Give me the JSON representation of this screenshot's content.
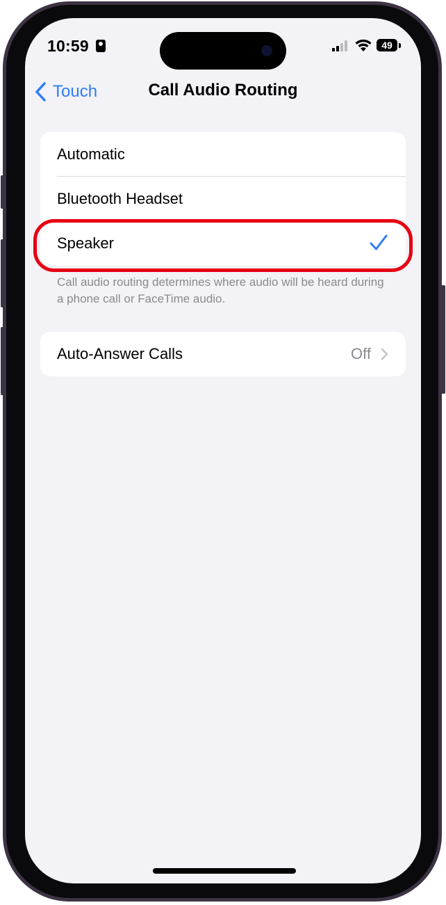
{
  "status_bar": {
    "time": "10:59",
    "battery": "49"
  },
  "nav": {
    "back_label": "Touch",
    "title": "Call Audio Routing"
  },
  "routing_options": [
    {
      "label": "Automatic",
      "selected": false
    },
    {
      "label": "Bluetooth Headset",
      "selected": false
    },
    {
      "label": "Speaker",
      "selected": true
    }
  ],
  "footnote": "Call audio routing determines where audio will be heard during a phone call or FaceTime audio.",
  "auto_answer": {
    "label": "Auto-Answer Calls",
    "value": "Off"
  },
  "colors": {
    "accent": "#2f7cf6",
    "highlight": "#e60012",
    "background": "#f2f2f7",
    "secondary_text": "#8a8a8e"
  }
}
